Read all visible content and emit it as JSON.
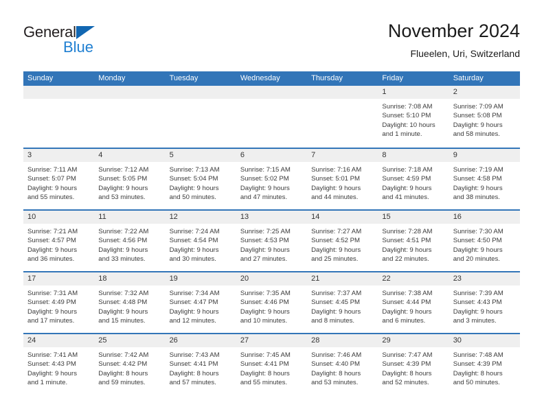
{
  "brand": {
    "word1": "General",
    "word2": "Blue",
    "triangle_color": "#1267b2",
    "word2_color": "#1f7fd1"
  },
  "header": {
    "title": "November 2024",
    "subtitle": "Flueelen, Uri, Switzerland"
  },
  "theme": {
    "header_blue": "#3275b8",
    "day_band_gray": "#efefef",
    "text_dark": "#333333",
    "text_body": "#3a3a3a"
  },
  "calendar": {
    "weekdays": [
      "Sunday",
      "Monday",
      "Tuesday",
      "Wednesday",
      "Thursday",
      "Friday",
      "Saturday"
    ],
    "weeks": [
      [
        {
          "day": "",
          "empty": true,
          "sunrise": "",
          "sunset": "",
          "daylight1": "",
          "daylight2": ""
        },
        {
          "day": "",
          "empty": true,
          "sunrise": "",
          "sunset": "",
          "daylight1": "",
          "daylight2": ""
        },
        {
          "day": "",
          "empty": true,
          "sunrise": "",
          "sunset": "",
          "daylight1": "",
          "daylight2": ""
        },
        {
          "day": "",
          "empty": true,
          "sunrise": "",
          "sunset": "",
          "daylight1": "",
          "daylight2": ""
        },
        {
          "day": "",
          "empty": true,
          "sunrise": "",
          "sunset": "",
          "daylight1": "",
          "daylight2": ""
        },
        {
          "day": "1",
          "empty": false,
          "sunrise": "Sunrise: 7:08 AM",
          "sunset": "Sunset: 5:10 PM",
          "daylight1": "Daylight: 10 hours",
          "daylight2": "and 1 minute."
        },
        {
          "day": "2",
          "empty": false,
          "sunrise": "Sunrise: 7:09 AM",
          "sunset": "Sunset: 5:08 PM",
          "daylight1": "Daylight: 9 hours",
          "daylight2": "and 58 minutes."
        }
      ],
      [
        {
          "day": "3",
          "empty": false,
          "sunrise": "Sunrise: 7:11 AM",
          "sunset": "Sunset: 5:07 PM",
          "daylight1": "Daylight: 9 hours",
          "daylight2": "and 55 minutes."
        },
        {
          "day": "4",
          "empty": false,
          "sunrise": "Sunrise: 7:12 AM",
          "sunset": "Sunset: 5:05 PM",
          "daylight1": "Daylight: 9 hours",
          "daylight2": "and 53 minutes."
        },
        {
          "day": "5",
          "empty": false,
          "sunrise": "Sunrise: 7:13 AM",
          "sunset": "Sunset: 5:04 PM",
          "daylight1": "Daylight: 9 hours",
          "daylight2": "and 50 minutes."
        },
        {
          "day": "6",
          "empty": false,
          "sunrise": "Sunrise: 7:15 AM",
          "sunset": "Sunset: 5:02 PM",
          "daylight1": "Daylight: 9 hours",
          "daylight2": "and 47 minutes."
        },
        {
          "day": "7",
          "empty": false,
          "sunrise": "Sunrise: 7:16 AM",
          "sunset": "Sunset: 5:01 PM",
          "daylight1": "Daylight: 9 hours",
          "daylight2": "and 44 minutes."
        },
        {
          "day": "8",
          "empty": false,
          "sunrise": "Sunrise: 7:18 AM",
          "sunset": "Sunset: 4:59 PM",
          "daylight1": "Daylight: 9 hours",
          "daylight2": "and 41 minutes."
        },
        {
          "day": "9",
          "empty": false,
          "sunrise": "Sunrise: 7:19 AM",
          "sunset": "Sunset: 4:58 PM",
          "daylight1": "Daylight: 9 hours",
          "daylight2": "and 38 minutes."
        }
      ],
      [
        {
          "day": "10",
          "empty": false,
          "sunrise": "Sunrise: 7:21 AM",
          "sunset": "Sunset: 4:57 PM",
          "daylight1": "Daylight: 9 hours",
          "daylight2": "and 36 minutes."
        },
        {
          "day": "11",
          "empty": false,
          "sunrise": "Sunrise: 7:22 AM",
          "sunset": "Sunset: 4:56 PM",
          "daylight1": "Daylight: 9 hours",
          "daylight2": "and 33 minutes."
        },
        {
          "day": "12",
          "empty": false,
          "sunrise": "Sunrise: 7:24 AM",
          "sunset": "Sunset: 4:54 PM",
          "daylight1": "Daylight: 9 hours",
          "daylight2": "and 30 minutes."
        },
        {
          "day": "13",
          "empty": false,
          "sunrise": "Sunrise: 7:25 AM",
          "sunset": "Sunset: 4:53 PM",
          "daylight1": "Daylight: 9 hours",
          "daylight2": "and 27 minutes."
        },
        {
          "day": "14",
          "empty": false,
          "sunrise": "Sunrise: 7:27 AM",
          "sunset": "Sunset: 4:52 PM",
          "daylight1": "Daylight: 9 hours",
          "daylight2": "and 25 minutes."
        },
        {
          "day": "15",
          "empty": false,
          "sunrise": "Sunrise: 7:28 AM",
          "sunset": "Sunset: 4:51 PM",
          "daylight1": "Daylight: 9 hours",
          "daylight2": "and 22 minutes."
        },
        {
          "day": "16",
          "empty": false,
          "sunrise": "Sunrise: 7:30 AM",
          "sunset": "Sunset: 4:50 PM",
          "daylight1": "Daylight: 9 hours",
          "daylight2": "and 20 minutes."
        }
      ],
      [
        {
          "day": "17",
          "empty": false,
          "sunrise": "Sunrise: 7:31 AM",
          "sunset": "Sunset: 4:49 PM",
          "daylight1": "Daylight: 9 hours",
          "daylight2": "and 17 minutes."
        },
        {
          "day": "18",
          "empty": false,
          "sunrise": "Sunrise: 7:32 AM",
          "sunset": "Sunset: 4:48 PM",
          "daylight1": "Daylight: 9 hours",
          "daylight2": "and 15 minutes."
        },
        {
          "day": "19",
          "empty": false,
          "sunrise": "Sunrise: 7:34 AM",
          "sunset": "Sunset: 4:47 PM",
          "daylight1": "Daylight: 9 hours",
          "daylight2": "and 12 minutes."
        },
        {
          "day": "20",
          "empty": false,
          "sunrise": "Sunrise: 7:35 AM",
          "sunset": "Sunset: 4:46 PM",
          "daylight1": "Daylight: 9 hours",
          "daylight2": "and 10 minutes."
        },
        {
          "day": "21",
          "empty": false,
          "sunrise": "Sunrise: 7:37 AM",
          "sunset": "Sunset: 4:45 PM",
          "daylight1": "Daylight: 9 hours",
          "daylight2": "and 8 minutes."
        },
        {
          "day": "22",
          "empty": false,
          "sunrise": "Sunrise: 7:38 AM",
          "sunset": "Sunset: 4:44 PM",
          "daylight1": "Daylight: 9 hours",
          "daylight2": "and 6 minutes."
        },
        {
          "day": "23",
          "empty": false,
          "sunrise": "Sunrise: 7:39 AM",
          "sunset": "Sunset: 4:43 PM",
          "daylight1": "Daylight: 9 hours",
          "daylight2": "and 3 minutes."
        }
      ],
      [
        {
          "day": "24",
          "empty": false,
          "sunrise": "Sunrise: 7:41 AM",
          "sunset": "Sunset: 4:43 PM",
          "daylight1": "Daylight: 9 hours",
          "daylight2": "and 1 minute."
        },
        {
          "day": "25",
          "empty": false,
          "sunrise": "Sunrise: 7:42 AM",
          "sunset": "Sunset: 4:42 PM",
          "daylight1": "Daylight: 8 hours",
          "daylight2": "and 59 minutes."
        },
        {
          "day": "26",
          "empty": false,
          "sunrise": "Sunrise: 7:43 AM",
          "sunset": "Sunset: 4:41 PM",
          "daylight1": "Daylight: 8 hours",
          "daylight2": "and 57 minutes."
        },
        {
          "day": "27",
          "empty": false,
          "sunrise": "Sunrise: 7:45 AM",
          "sunset": "Sunset: 4:41 PM",
          "daylight1": "Daylight: 8 hours",
          "daylight2": "and 55 minutes."
        },
        {
          "day": "28",
          "empty": false,
          "sunrise": "Sunrise: 7:46 AM",
          "sunset": "Sunset: 4:40 PM",
          "daylight1": "Daylight: 8 hours",
          "daylight2": "and 53 minutes."
        },
        {
          "day": "29",
          "empty": false,
          "sunrise": "Sunrise: 7:47 AM",
          "sunset": "Sunset: 4:39 PM",
          "daylight1": "Daylight: 8 hours",
          "daylight2": "and 52 minutes."
        },
        {
          "day": "30",
          "empty": false,
          "sunrise": "Sunrise: 7:48 AM",
          "sunset": "Sunset: 4:39 PM",
          "daylight1": "Daylight: 8 hours",
          "daylight2": "and 50 minutes."
        }
      ]
    ]
  }
}
